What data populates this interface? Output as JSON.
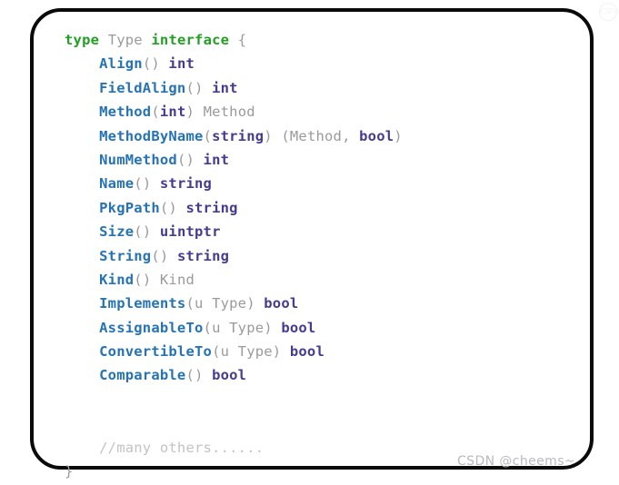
{
  "card": {
    "border_color": "#0a0a0a",
    "background": "#ffffff"
  },
  "syntax_colors": {
    "keyword": "#23a024",
    "function": "#2573b5",
    "type": "#453b90",
    "plain": "#9a9a9a",
    "comment": "#c3c3c3"
  },
  "code": {
    "language": "go",
    "lines": [
      {
        "indent": 0,
        "tokens": [
          {
            "text": "type",
            "kind": "keyword"
          },
          {
            "text": " ",
            "kind": "plain"
          },
          {
            "text": "Type",
            "kind": "plain"
          },
          {
            "text": " ",
            "kind": "plain"
          },
          {
            "text": "interface",
            "kind": "keyword"
          },
          {
            "text": " ",
            "kind": "plain"
          },
          {
            "text": "{",
            "kind": "plain"
          }
        ]
      },
      {
        "indent": 1,
        "tokens": [
          {
            "text": "Align",
            "kind": "function"
          },
          {
            "text": "() ",
            "kind": "plain"
          },
          {
            "text": "int",
            "kind": "type"
          }
        ]
      },
      {
        "indent": 1,
        "tokens": [
          {
            "text": "FieldAlign",
            "kind": "function"
          },
          {
            "text": "() ",
            "kind": "plain"
          },
          {
            "text": "int",
            "kind": "type"
          }
        ]
      },
      {
        "indent": 1,
        "tokens": [
          {
            "text": "Method",
            "kind": "function"
          },
          {
            "text": "(",
            "kind": "plain"
          },
          {
            "text": "int",
            "kind": "type"
          },
          {
            "text": ") ",
            "kind": "plain"
          },
          {
            "text": "Method",
            "kind": "plain"
          }
        ]
      },
      {
        "indent": 1,
        "tokens": [
          {
            "text": "MethodByName",
            "kind": "function"
          },
          {
            "text": "(",
            "kind": "plain"
          },
          {
            "text": "string",
            "kind": "type"
          },
          {
            "text": ") (Method, ",
            "kind": "plain"
          },
          {
            "text": "bool",
            "kind": "type"
          },
          {
            "text": ")",
            "kind": "plain"
          }
        ]
      },
      {
        "indent": 1,
        "tokens": [
          {
            "text": "NumMethod",
            "kind": "function"
          },
          {
            "text": "() ",
            "kind": "plain"
          },
          {
            "text": "int",
            "kind": "type"
          }
        ]
      },
      {
        "indent": 1,
        "tokens": [
          {
            "text": "Name",
            "kind": "function"
          },
          {
            "text": "() ",
            "kind": "plain"
          },
          {
            "text": "string",
            "kind": "type"
          }
        ]
      },
      {
        "indent": 1,
        "tokens": [
          {
            "text": "PkgPath",
            "kind": "function"
          },
          {
            "text": "() ",
            "kind": "plain"
          },
          {
            "text": "string",
            "kind": "type"
          }
        ]
      },
      {
        "indent": 1,
        "tokens": [
          {
            "text": "Size",
            "kind": "function"
          },
          {
            "text": "() ",
            "kind": "plain"
          },
          {
            "text": "uintptr",
            "kind": "type"
          }
        ]
      },
      {
        "indent": 1,
        "tokens": [
          {
            "text": "String",
            "kind": "function"
          },
          {
            "text": "() ",
            "kind": "plain"
          },
          {
            "text": "string",
            "kind": "type"
          }
        ]
      },
      {
        "indent": 1,
        "tokens": [
          {
            "text": "Kind",
            "kind": "function"
          },
          {
            "text": "() ",
            "kind": "plain"
          },
          {
            "text": "Kind",
            "kind": "plain"
          }
        ]
      },
      {
        "indent": 1,
        "tokens": [
          {
            "text": "Implements",
            "kind": "function"
          },
          {
            "text": "(u Type) ",
            "kind": "plain"
          },
          {
            "text": "bool",
            "kind": "type"
          }
        ]
      },
      {
        "indent": 1,
        "tokens": [
          {
            "text": "AssignableTo",
            "kind": "function"
          },
          {
            "text": "(u Type) ",
            "kind": "plain"
          },
          {
            "text": "bool",
            "kind": "type"
          }
        ]
      },
      {
        "indent": 1,
        "tokens": [
          {
            "text": "ConvertibleTo",
            "kind": "function"
          },
          {
            "text": "(u Type) ",
            "kind": "plain"
          },
          {
            "text": "bool",
            "kind": "type"
          }
        ]
      },
      {
        "indent": 1,
        "tokens": [
          {
            "text": "Comparable",
            "kind": "function"
          },
          {
            "text": "() ",
            "kind": "plain"
          },
          {
            "text": "bool",
            "kind": "type"
          }
        ]
      },
      {
        "indent": 0,
        "tokens": []
      },
      {
        "indent": 0,
        "tokens": []
      },
      {
        "indent": 1,
        "tokens": [
          {
            "text": "//many others......",
            "kind": "comment"
          }
        ]
      },
      {
        "indent": 0,
        "tokens": [
          {
            "text": "}",
            "kind": "plain"
          }
        ]
      }
    ]
  },
  "watermarks": {
    "bottom_right": "CSDN @cheems~",
    "top_right": "CSDN"
  }
}
